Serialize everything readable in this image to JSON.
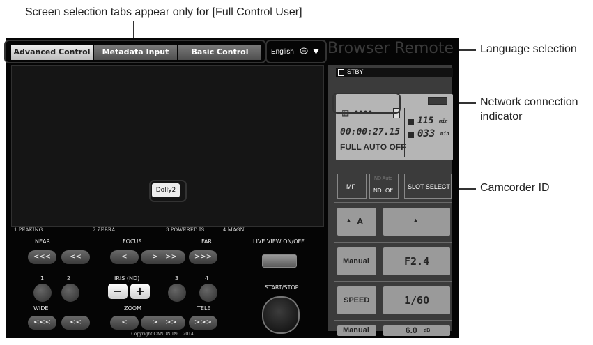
{
  "callouts": {
    "tabs_note": "Screen selection tabs appear only for [Full Control User]",
    "language": "Language selection",
    "network": "Network connection indicator",
    "network_line1": "Network connection",
    "network_line2": "indicator",
    "camcorder_id": "Camcorder ID"
  },
  "tabs": [
    {
      "label": "Advanced Control",
      "active": true
    },
    {
      "label": "Metadata Input",
      "active": false
    },
    {
      "label": "Basic Control",
      "active": false
    }
  ],
  "language": {
    "value": "English",
    "speech_icon": "speech-bubble-icon",
    "arrow_icon": "triangle-down-icon"
  },
  "brand": "Browser Remote",
  "camera": {
    "id": "Dolly2"
  },
  "assign_buttons": [
    "1.PEAKING",
    "2.ZEBRA",
    "3.POWERED IS",
    "4.MAGN."
  ],
  "focus": {
    "near": "NEAR",
    "title": "FOCUS",
    "far": "FAR",
    "buttons": [
      "<<<",
      "<<",
      "<",
      ">",
      ">>",
      ">>>"
    ]
  },
  "iris": {
    "title": "IRIS (ND)",
    "minus": "−",
    "plus": "+",
    "numbers": [
      "1",
      "2",
      "3",
      "4"
    ]
  },
  "zoom": {
    "wide": "WIDE",
    "title": "ZOOM",
    "tele": "TELE",
    "buttons": [
      "<<<",
      "<<",
      "<",
      ">",
      ">>",
      ">>>"
    ]
  },
  "live_view": "LIVE VIEW ON/OFF",
  "start_stop": "START/STOP",
  "copyright": "Copyright CANON INC. 2014",
  "status": {
    "mode": "STBY",
    "network_dots": "●●●●",
    "slot_a_time": "115",
    "slot_b_time": "033",
    "min_unit": "min",
    "timecode": "00:00:27.15",
    "auto_mode": "FULL AUTO OFF"
  },
  "controls": {
    "mf": "MF",
    "nd_auto": "ND Auto",
    "nd": "ND",
    "nd_off": "Off",
    "slot_select": "SLOT SELECT",
    "wb_a": "A",
    "iris_mode": "Manual",
    "iris_value": "F2.4",
    "speed_label": "SPEED",
    "speed_value": "1/60",
    "gain_mode": "Manual",
    "gain_value": "6.0",
    "gain_unit": "dB"
  }
}
